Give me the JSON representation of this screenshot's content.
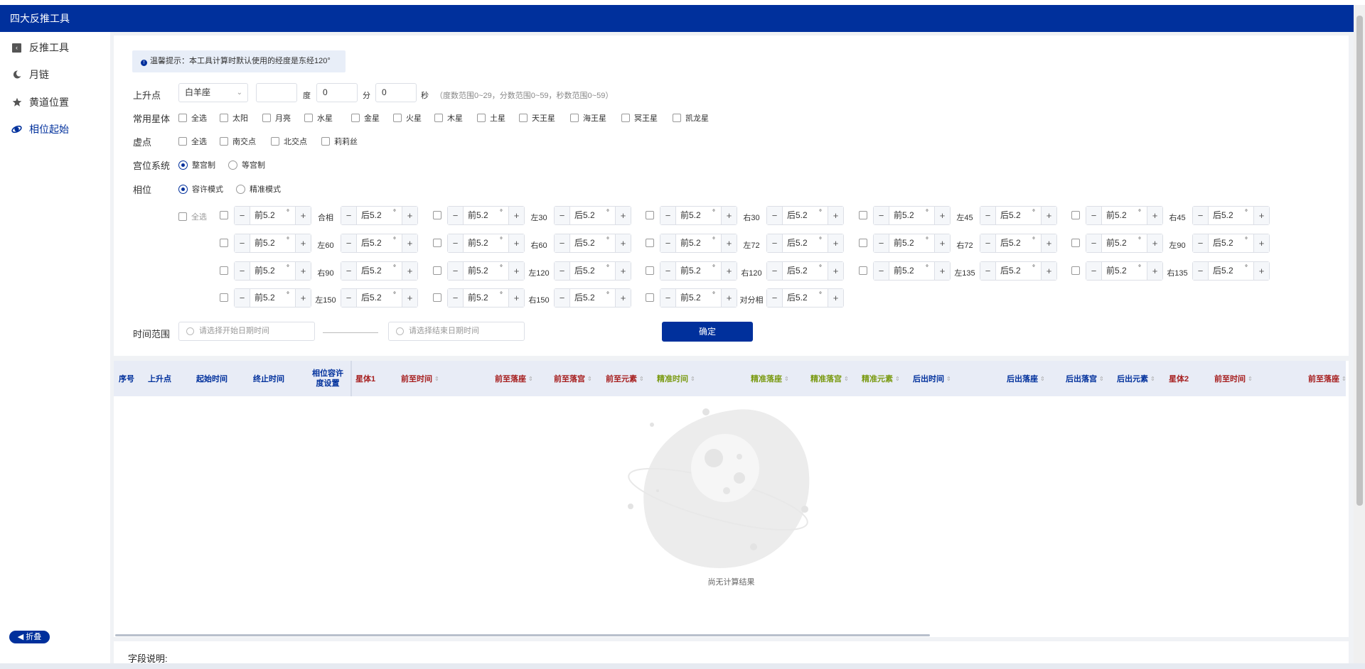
{
  "app": {
    "title": "四大反推工具"
  },
  "sidebar": {
    "items": [
      {
        "label": "反推工具",
        "icon": "back-box-icon"
      },
      {
        "label": "月链",
        "icon": "moon-icon"
      },
      {
        "label": "黄道位置",
        "icon": "star-icon"
      },
      {
        "label": "相位起始",
        "icon": "aspect-icon",
        "active": true
      }
    ],
    "fold_label": "折叠"
  },
  "form": {
    "tip": "温馨提示：本工具计算时默认使用的经度是东经120°",
    "ascendant": {
      "label": "上升点",
      "sign": "白羊座",
      "degree_value": "",
      "degree_unit": "度",
      "minute_value": "0",
      "minute_unit": "分",
      "second_value": "0",
      "second_unit": "秒",
      "hint": "（度数范围0~29，分数范围0~59，秒数范围0~59）"
    },
    "planets": {
      "label": "常用星体",
      "options": [
        "全选",
        "太阳",
        "月亮",
        "水星",
        "金星",
        "火星",
        "木星",
        "土星",
        "天王星",
        "海王星",
        "冥王星",
        "凯龙星"
      ]
    },
    "points": {
      "label": "虚点",
      "options": [
        "全选",
        "南交点",
        "北交点",
        "莉莉丝"
      ]
    },
    "house_system": {
      "label": "宫位系统",
      "options": [
        "整宫制",
        "等宫制"
      ],
      "selected": "整宫制"
    },
    "aspect": {
      "label": "相位",
      "modes": [
        "容许模式",
        "精准模式"
      ],
      "selected": "容许模式",
      "select_all": "全选",
      "before_value": "前5.2",
      "after_value": "后5.2",
      "degree_symbol": "°",
      "names": [
        "合相",
        "左30",
        "右30",
        "左45",
        "右45",
        "左60",
        "右60",
        "左72",
        "右72",
        "左90",
        "右90",
        "左120",
        "右120",
        "左135",
        "右135",
        "左150",
        "右150",
        "对分相"
      ]
    },
    "time_range": {
      "label": "时间范围",
      "start_placeholder": "请选择开始日期时间",
      "end_placeholder": "请选择结束日期时间"
    },
    "confirm_label": "确定"
  },
  "table": {
    "columns": [
      {
        "label": "序号",
        "color": "blue"
      },
      {
        "label": "上升点",
        "color": "blue"
      },
      {
        "label": "起始时间",
        "color": "blue"
      },
      {
        "label": "终止时间",
        "color": "blue"
      },
      {
        "label": "相位容许度设置",
        "color": "blue"
      },
      {
        "label": "星体1",
        "color": "red"
      },
      {
        "label": "前至时间",
        "color": "red",
        "sortable": true
      },
      {
        "label": "前至落座",
        "color": "red",
        "sortable": true
      },
      {
        "label": "前至落宫",
        "color": "red",
        "sortable": true
      },
      {
        "label": "前至元素",
        "color": "red",
        "sortable": true
      },
      {
        "label": "精准时间",
        "color": "olive",
        "sortable": true
      },
      {
        "label": "精准落座",
        "color": "olive",
        "sortable": true
      },
      {
        "label": "精准落宫",
        "color": "olive",
        "sortable": true
      },
      {
        "label": "精准元素",
        "color": "olive",
        "sortable": true
      },
      {
        "label": "后出时间",
        "color": "blue",
        "sortable": true
      },
      {
        "label": "后出落座",
        "color": "blue",
        "sortable": true
      },
      {
        "label": "后出落宫",
        "color": "blue",
        "sortable": true
      },
      {
        "label": "后出元素",
        "color": "blue",
        "sortable": true
      },
      {
        "label": "星体2",
        "color": "red"
      },
      {
        "label": "前至时间",
        "color": "red",
        "sortable": true
      },
      {
        "label": "前至落座",
        "color": "red",
        "sortable": true
      }
    ],
    "empty_text": "尚无计算结果"
  },
  "field_notes": {
    "title": "字段说明:"
  },
  "colors": {
    "brand": "#00309c",
    "red_header": "#a61e1e",
    "olive_header": "#7a9a12"
  }
}
